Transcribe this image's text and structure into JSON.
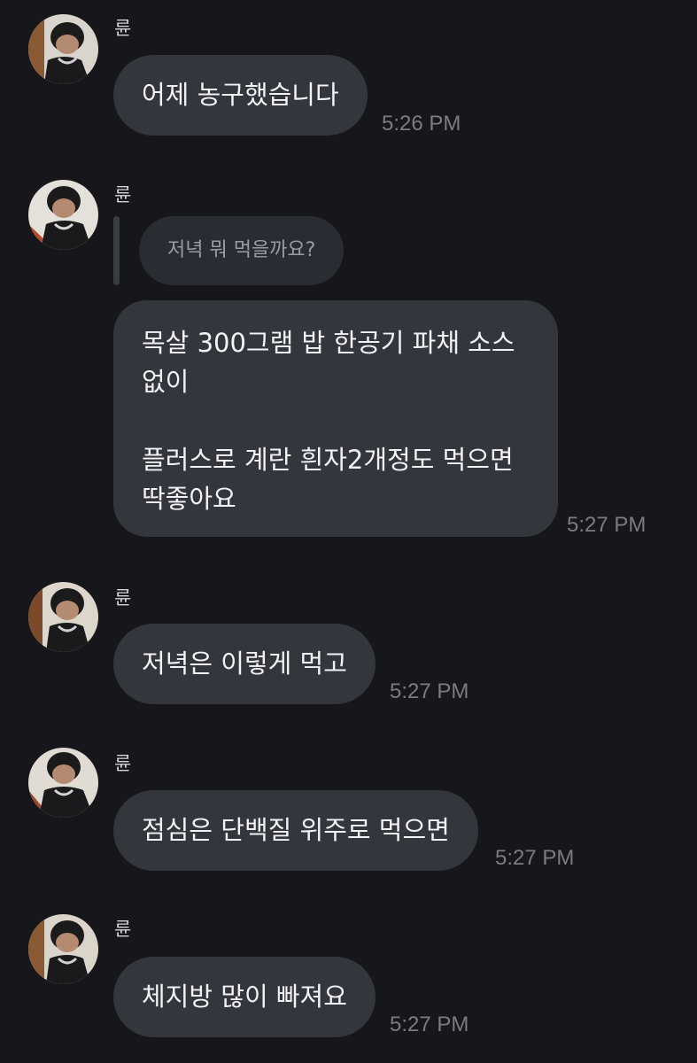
{
  "messages": [
    {
      "sender": "륜",
      "reply_to": null,
      "text": "어제 농구했습니다",
      "time": "5:26 PM"
    },
    {
      "sender": "륜",
      "reply_to": "저녁 뭐 먹을까요?",
      "text": "목살 300그램 밥 한공기 파채 소스\n없이\n\n플러스로 계란 흰자2개정도 먹으면\n딱좋아요",
      "time": "5:27 PM"
    },
    {
      "sender": "륜",
      "reply_to": null,
      "text": "저녁은 이렇게 먹고",
      "time": "5:27 PM"
    },
    {
      "sender": "륜",
      "reply_to": null,
      "text": "점심은 단백질 위주로 먹으면",
      "time": "5:27 PM"
    },
    {
      "sender": "륜",
      "reply_to": null,
      "text": "체지방 많이 빠져요",
      "time": "5:27 PM"
    }
  ],
  "colors": {
    "background": "#17171b",
    "bubble": "#34363e",
    "reply_bubble": "#2a2c33",
    "timestamp": "#7a7c83"
  }
}
